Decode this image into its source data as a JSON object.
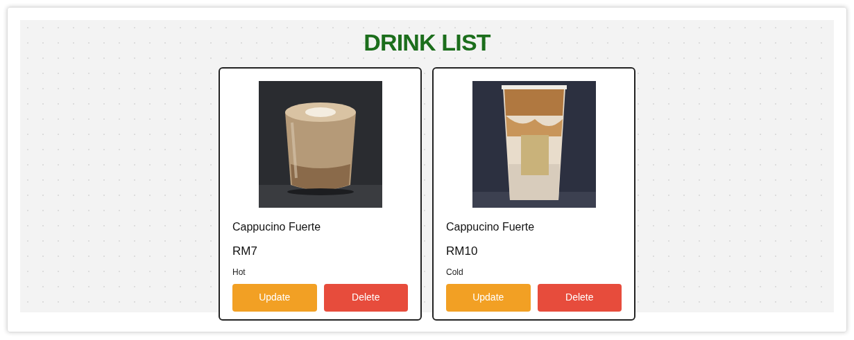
{
  "title": "DRINK LIST",
  "drinks": [
    {
      "name": "Cappucino Fuerte",
      "price": "RM7",
      "type": "Hot",
      "update": "Update",
      "delete": "Delete"
    },
    {
      "name": "Cappucino Fuerte",
      "price": "RM10",
      "type": "Cold",
      "update": "Update",
      "delete": "Delete"
    }
  ]
}
